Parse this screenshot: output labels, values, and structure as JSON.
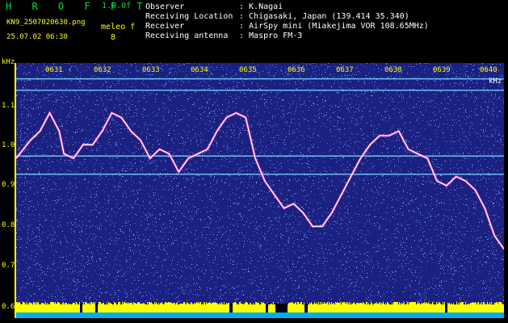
{
  "header": {
    "title": "H R O F F T",
    "version": "1.0.0f",
    "filename": "KN9_2507020630.png",
    "datetime": "25.07.02 06:30",
    "meleo_label": "meleo f",
    "meleo_value": "8"
  },
  "info": {
    "observer_label": "Observer",
    "observer_value": ": K.Nagai",
    "location_label": "Receiving Location",
    "location_value": ": Chigasaki, Japan (139.414 35.340)",
    "receiver_label": "Receiver",
    "receiver_value": ": AirSpy mini (Miakejima VOR 108.65MHz)",
    "antenna_label": "Receiving antenna",
    "antenna_value": ": Maspro FM-3"
  },
  "axis": {
    "unit": "kHz",
    "unit_right": "kHz",
    "y_ticks": [
      "1.1",
      "1.0",
      "0.9",
      "0.8",
      "0.7",
      "0.6"
    ],
    "x_ticks": [
      "0631",
      "0632",
      "0633",
      "0634",
      "0635",
      "0636",
      "0637",
      "0638",
      "0639",
      "0640"
    ]
  },
  "chart_data": {
    "type": "line",
    "title": "",
    "xlabel": "",
    "ylabel": "kHz",
    "ylim": [
      0.6,
      1.13
    ],
    "xlim": [
      630.0,
      640.2
    ],
    "series": [
      {
        "values": [
          [
            630.0,
            0.92
          ],
          [
            630.3,
            0.96
          ],
          [
            630.5,
            0.98
          ],
          [
            630.7,
            1.02
          ],
          [
            630.9,
            0.98
          ],
          [
            631.0,
            0.93
          ],
          [
            631.2,
            0.92
          ],
          [
            631.4,
            0.95
          ],
          [
            631.6,
            0.95
          ],
          [
            631.8,
            0.98
          ],
          [
            632.0,
            1.02
          ],
          [
            632.2,
            1.01
          ],
          [
            632.4,
            0.98
          ],
          [
            632.6,
            0.96
          ],
          [
            632.8,
            0.92
          ],
          [
            633.0,
            0.94
          ],
          [
            633.2,
            0.93
          ],
          [
            633.4,
            0.89
          ],
          [
            633.6,
            0.92
          ],
          [
            633.8,
            0.93
          ],
          [
            634.0,
            0.94
          ],
          [
            634.2,
            0.98
          ],
          [
            634.4,
            1.01
          ],
          [
            634.6,
            1.02
          ],
          [
            634.8,
            1.01
          ],
          [
            635.0,
            0.92
          ],
          [
            635.2,
            0.87
          ],
          [
            635.4,
            0.84
          ],
          [
            635.6,
            0.81
          ],
          [
            635.8,
            0.82
          ],
          [
            636.0,
            0.8
          ],
          [
            636.2,
            0.77
          ],
          [
            636.4,
            0.77
          ],
          [
            636.6,
            0.8
          ],
          [
            636.8,
            0.84
          ],
          [
            637.0,
            0.88
          ],
          [
            637.2,
            0.92
          ],
          [
            637.4,
            0.95
          ],
          [
            637.6,
            0.97
          ],
          [
            637.8,
            0.97
          ],
          [
            638.0,
            0.98
          ],
          [
            638.2,
            0.94
          ],
          [
            638.4,
            0.93
          ],
          [
            638.6,
            0.92
          ],
          [
            638.8,
            0.87
          ],
          [
            639.0,
            0.86
          ],
          [
            639.2,
            0.88
          ],
          [
            639.4,
            0.87
          ],
          [
            639.6,
            0.85
          ],
          [
            639.8,
            0.81
          ],
          [
            640.0,
            0.75
          ],
          [
            640.2,
            0.72
          ]
        ]
      }
    ],
    "horizontal_lines": [
      1.095,
      1.07,
      0.925,
      0.885
    ],
    "grid": false,
    "colors": {
      "background": "#1a2180",
      "noise": "#6f86ff",
      "trace": "#ffffff",
      "trace_tint": "#ff40c0",
      "level_bar": "#ffff00",
      "level_base": "#00b0f0",
      "axis_text": "#ffff00",
      "header_green": "#00e040"
    }
  }
}
